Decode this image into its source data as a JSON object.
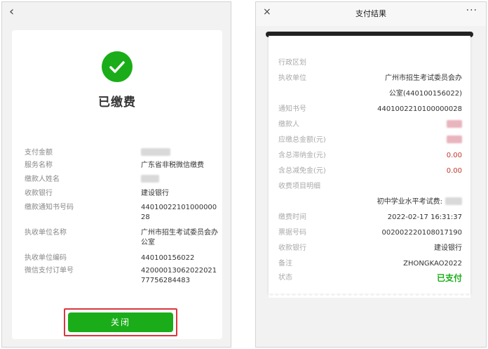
{
  "left": {
    "status_title": "已缴费",
    "rows": [
      {
        "label": "支付金额",
        "value": ""
      },
      {
        "label": "服务名称",
        "value": "广东省非税微信缴费"
      },
      {
        "label": "缴款人姓名",
        "value": ""
      },
      {
        "label": "收款银行",
        "value": "建设银行"
      },
      {
        "label": "缴款通知书号码",
        "value": "4401002210100000028"
      },
      {
        "label": "执收单位名称",
        "value": "广州市招生考试委员会办公室"
      },
      {
        "label": "执收单位编码",
        "value": "440100156022"
      },
      {
        "label": "微信支付订单号",
        "value": "4200001306202202177756284483"
      }
    ],
    "close_label": "关闭"
  },
  "right": {
    "header_title": "支付结果",
    "close_icon": "×",
    "more_icon": "···",
    "rows": [
      {
        "label": "行政区划",
        "value": ""
      },
      {
        "label": "执收单位",
        "value": "广州市招生考试委员会办"
      },
      {
        "label": "",
        "value": "公室(440100156022)"
      },
      {
        "label": "通知书号",
        "value": "4401002210100000028"
      },
      {
        "label": "缴款人",
        "value": ""
      },
      {
        "label": "应缴总金额(元)",
        "value": ""
      },
      {
        "label": "含总滞纳金(元)",
        "value": "0.00"
      },
      {
        "label": "含总减免金(元)",
        "value": "0.00"
      },
      {
        "label": "收费项目明细",
        "value": ""
      },
      {
        "label": "",
        "value": "初中学业水平考试费:"
      },
      {
        "label": "缴费时间",
        "value": "2022-02-17 16:31:37"
      },
      {
        "label": "票据号码",
        "value": "002002220108017190"
      },
      {
        "label": "收款银行",
        "value": "建设银行"
      },
      {
        "label": "备注",
        "value": "ZHONGKAO2022"
      },
      {
        "label": "状态",
        "value": "已支付"
      }
    ]
  },
  "colors": {
    "wechat_green": "#1aad19",
    "highlight_red": "#d9363e",
    "amount_red": "#c0392b"
  }
}
